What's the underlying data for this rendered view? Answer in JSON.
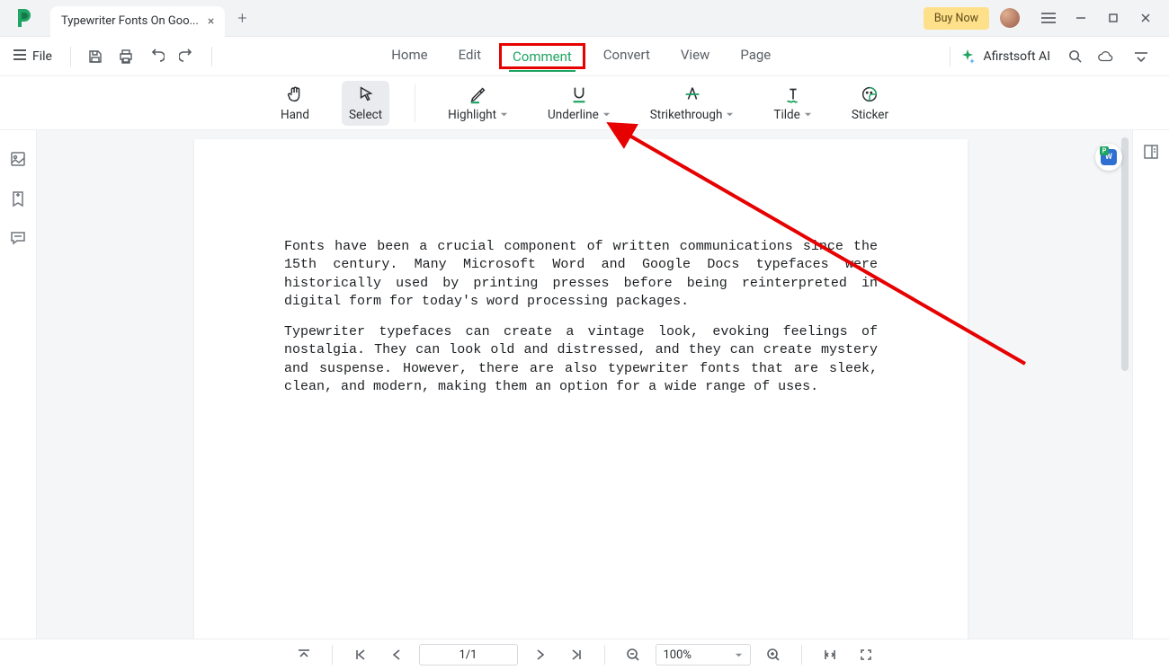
{
  "titlebar": {
    "tab_title": "Typewriter Fonts On Goo...",
    "buy_now": "Buy Now"
  },
  "menubar": {
    "file": "File",
    "items": [
      "Home",
      "Edit",
      "Comment",
      "Convert",
      "View",
      "Page"
    ],
    "active_index": 2,
    "ai_name": "Afirstsoft AI"
  },
  "ribbon": {
    "tools": [
      {
        "name": "hand",
        "label": "Hand",
        "dropdown": false
      },
      {
        "name": "select",
        "label": "Select",
        "dropdown": false,
        "selected": true
      },
      {
        "name": "highlight",
        "label": "Highlight",
        "dropdown": true
      },
      {
        "name": "underline",
        "label": "Underline",
        "dropdown": true
      },
      {
        "name": "strikethrough",
        "label": "Strikethrough",
        "dropdown": true
      },
      {
        "name": "tilde",
        "label": "Tilde",
        "dropdown": true
      },
      {
        "name": "sticker",
        "label": "Sticker",
        "dropdown": false
      }
    ]
  },
  "document": {
    "para1": "Fonts have been a crucial component of written communications since the 15th century. Many Microsoft Word and Google Docs typefaces were historically used by printing presses before being reinterpreted in digital form for today's word processing packages.",
    "para2": "Typewriter typefaces can create a vintage look, evoking feelings of nostalgia. They can look old and distressed, and they can create mystery and suspense. However, there are also typewriter fonts that are sleek, clean, and modern, making them an option for a wide range of uses."
  },
  "statusbar": {
    "page": "1/1",
    "zoom": "100%"
  },
  "annotation": {
    "highlight_color": "#e60000"
  }
}
